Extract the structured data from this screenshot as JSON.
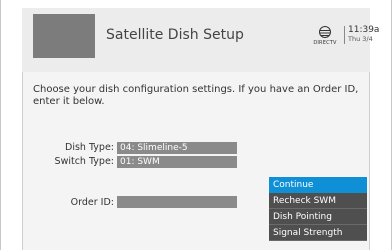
{
  "header": {
    "title": "Satellite Dish Setup",
    "logo_text": "DIRECTV",
    "time": "11:39a",
    "date": "Thu 3/4"
  },
  "main": {
    "instructions": "Choose your dish configuration settings. If you have an Order ID, enter it below.",
    "dish_type_label": "Dish Type:",
    "dish_type_value": "04: Slimeline-5",
    "switch_type_label": "Switch Type:",
    "switch_type_value": "01: SWM",
    "order_id_label": "Order ID:",
    "order_id_value": ""
  },
  "menu": {
    "items": [
      {
        "label": "Continue",
        "selected": true
      },
      {
        "label": "Recheck SWM",
        "selected": false
      },
      {
        "label": "Dish Pointing",
        "selected": false
      },
      {
        "label": "Signal Strength",
        "selected": false
      }
    ]
  },
  "colors": {
    "accent": "#0f8fd6",
    "field_bg": "#8a8a8a",
    "menu_bg": "#4f4f4f",
    "header_bg": "#ececec",
    "content_bg": "#f4f4f4"
  }
}
